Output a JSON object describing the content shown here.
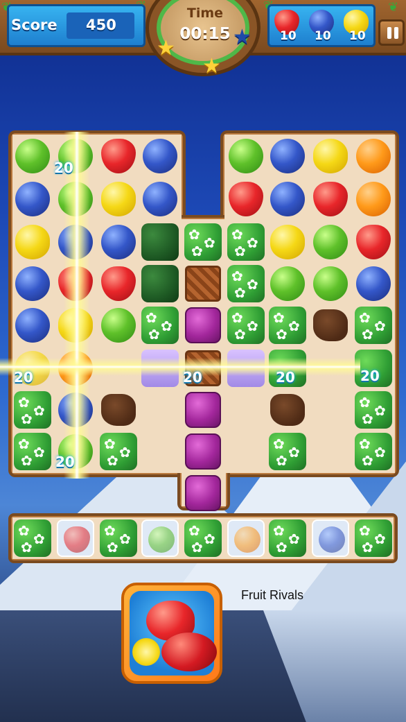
{
  "hud": {
    "score_label": "Score",
    "score_value": "450",
    "time_label": "Time",
    "time_value": "00:15",
    "stars_earned": 2,
    "stars_total": 3,
    "goals": [
      {
        "fruit": "strawberry",
        "count": "10"
      },
      {
        "fruit": "blueberry",
        "count": "10"
      },
      {
        "fruit": "lemon",
        "count": "10"
      }
    ],
    "pause_icon": "pause-icon"
  },
  "board": {
    "points_popups": [
      "20",
      "20",
      "20",
      "20",
      "20",
      "20"
    ]
  },
  "ad": {
    "title": "Fruit Rivals",
    "icon": "fruit-rivals-app-icon"
  },
  "colors": {
    "hud_blue": "#1e7fcf",
    "wood": "#b9793d",
    "timer_ring": "#4fb848"
  }
}
